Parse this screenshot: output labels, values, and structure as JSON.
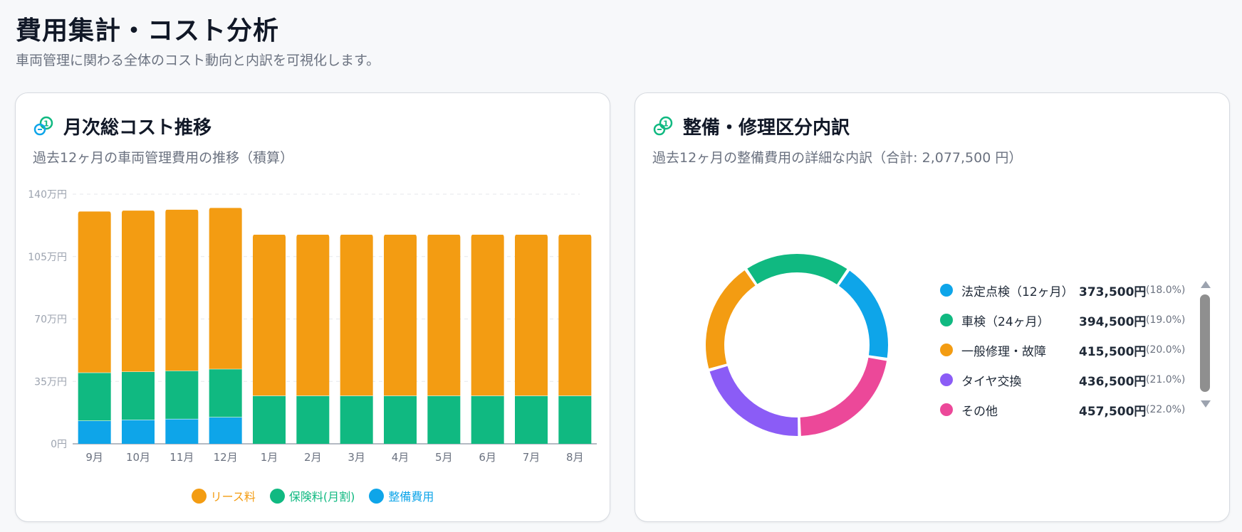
{
  "page": {
    "title": "費用集計・コスト分析",
    "subtitle": "車両管理に関わる全体のコスト動向と内訳を可視化します。"
  },
  "cost_card": {
    "title": "月次総コスト推移",
    "description": "過去12ヶ月の車両管理費用の推移（積算）",
    "icon": "cost-coins-icon"
  },
  "breakdown_card": {
    "title": "整備・修理区分内訳",
    "description": "過去12ヶ月の整備費用の詳細な内訳（合計: 2,077,500 円）",
    "icon": "maintenance-coins-icon"
  },
  "colors": {
    "lease": "#f39c12",
    "insurance": "#10b981",
    "maintenance": "#0ea5e9",
    "statutory": "#0ea5e9",
    "shaken": "#10b981",
    "repair": "#f39c12",
    "tire": "#8b5cf6",
    "other": "#ec4899"
  },
  "chart_data": [
    {
      "type": "bar",
      "stacked": true,
      "categories": [
        "9月",
        "10月",
        "11月",
        "12月",
        "1月",
        "2月",
        "3月",
        "4月",
        "5月",
        "6月",
        "7月",
        "8月"
      ],
      "series": [
        {
          "name": "整備費用",
          "color": "#0ea5e9",
          "values": [
            130000,
            135000,
            140000,
            150000,
            0,
            0,
            0,
            0,
            0,
            0,
            0,
            0
          ]
        },
        {
          "name": "保険料(月割)",
          "color": "#10b981",
          "values": [
            270000,
            270000,
            270000,
            270000,
            270000,
            270000,
            270000,
            270000,
            270000,
            270000,
            270000,
            270000
          ]
        },
        {
          "name": "リース料",
          "color": "#f39c12",
          "values": [
            905000,
            905000,
            905000,
            905000,
            905000,
            905000,
            905000,
            905000,
            905000,
            905000,
            905000,
            905000
          ]
        }
      ],
      "yticks": [
        "0円",
        "35万円",
        "70万円",
        "105万円",
        "140万円"
      ],
      "ylim": [
        0,
        1400000
      ],
      "grid": true,
      "legend_position": "bottom",
      "legend": [
        "リース料",
        "保険料(月割)",
        "整備費用"
      ]
    },
    {
      "type": "pie",
      "donut": true,
      "labels": [
        "法定点検（12ヶ月）",
        "車検（24ヶ月）",
        "一般修理・故障",
        "タイヤ交換",
        "その他"
      ],
      "values": [
        373500,
        394500,
        415500,
        436500,
        457500
      ],
      "value_labels": [
        "373,500円",
        "394,500円",
        "415,500円",
        "436,500円",
        "457,500円"
      ],
      "percent_labels": [
        "(18.0%)",
        "(19.0%)",
        "(20.0%)",
        "(21.0%)",
        "(22.0%)"
      ],
      "colors": [
        "#0ea5e9",
        "#10b981",
        "#f39c12",
        "#8b5cf6",
        "#ec4899"
      ],
      "legend_position": "right"
    }
  ]
}
